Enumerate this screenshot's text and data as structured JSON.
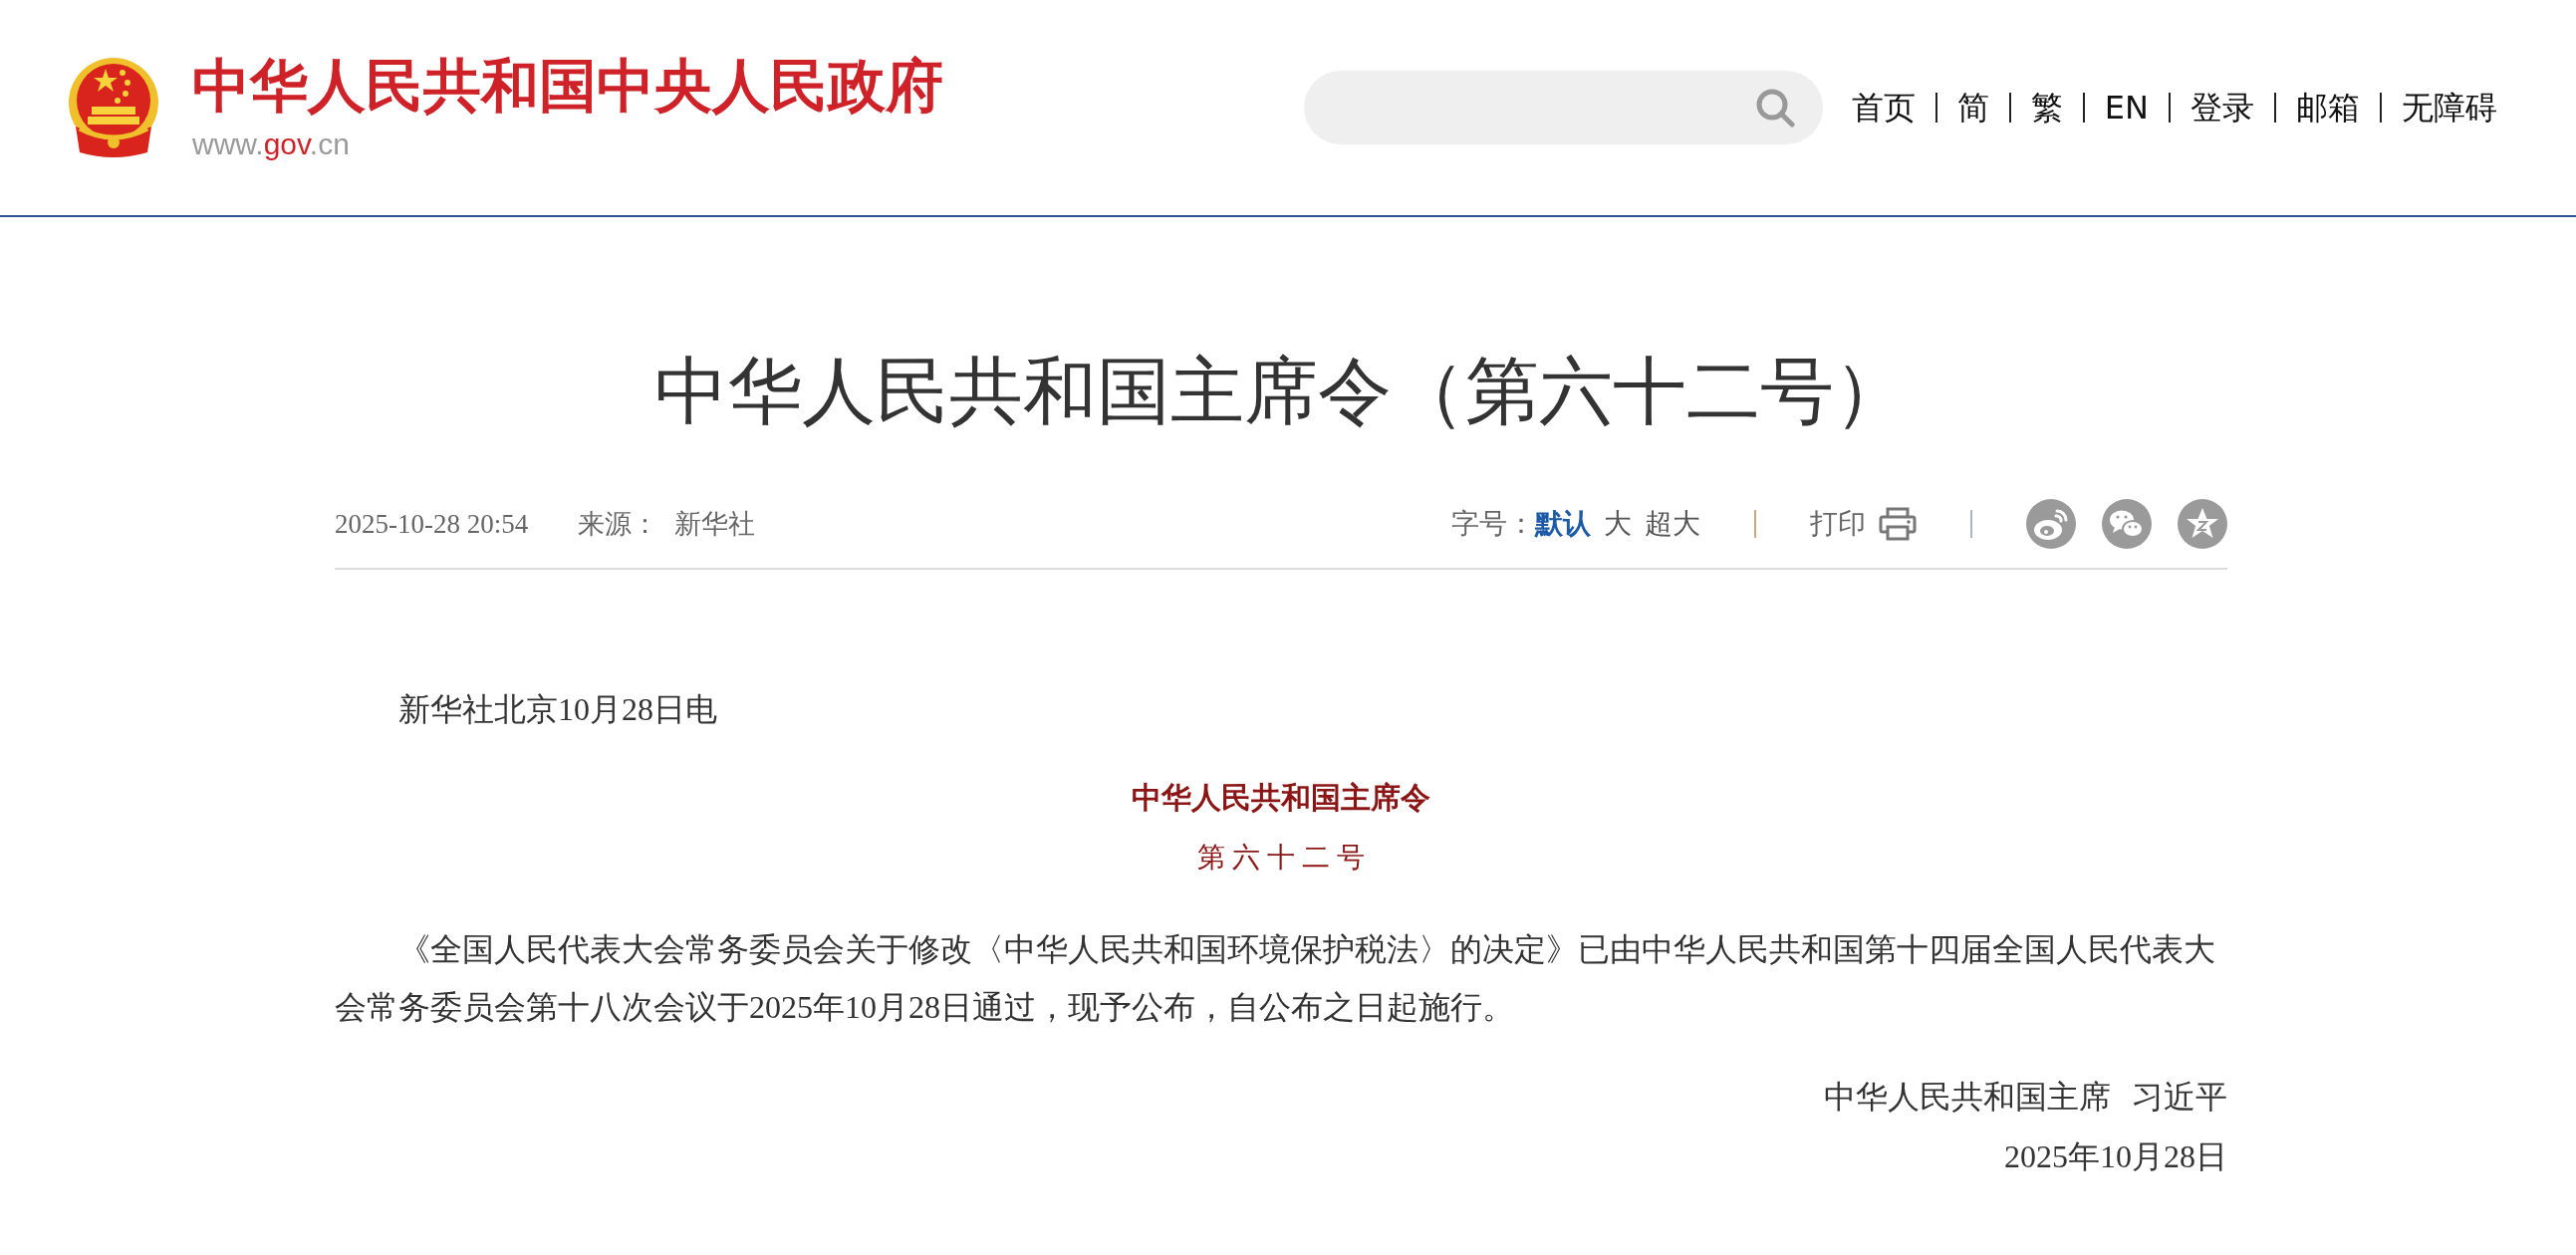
{
  "header": {
    "site_title": "中华人民共和国中央人民政府",
    "site_url": [
      {
        "text": "www.",
        "kind": "plain"
      },
      {
        "text": "gov",
        "kind": "accent"
      },
      {
        "text": ".cn",
        "kind": "plain"
      }
    ],
    "nav": [
      {
        "label": "首页"
      },
      {
        "label": "简"
      },
      {
        "label": "繁"
      },
      {
        "label": "EN"
      },
      {
        "label": "登录"
      },
      {
        "label": "邮箱"
      },
      {
        "label": "无障碍"
      }
    ]
  },
  "article": {
    "title": "中华人民共和国主席令（第六十二号）",
    "meta": {
      "datetime": "2025-10-28 20:54",
      "source_label": "来源：",
      "source": "新华社"
    },
    "font_size": {
      "label": "字号：",
      "options": [
        {
          "label": "默认",
          "selected": true
        },
        {
          "label": "大",
          "selected": false
        },
        {
          "label": "超大",
          "selected": false
        }
      ]
    },
    "print": {
      "label": "打印"
    },
    "body": [
      {
        "kind": "dateline",
        "text": "新华社北京10月28日电"
      },
      {
        "kind": "heading",
        "text": "中华人民共和国主席令"
      },
      {
        "kind": "number",
        "text": "第六十二号"
      },
      {
        "kind": "paragraph",
        "text": "《全国人民代表大会常务委员会关于修改〈中华人民共和国环境保护税法〉的决定》已由中华人民共和国第十四届全国人民代表大会常务委员会第十八次会议于2025年10月28日通过，现予公布，自公布之日起施行。"
      },
      {
        "kind": "signature",
        "text": "中华人民共和国主席 习近平"
      },
      {
        "kind": "date",
        "text": "2025年10月28日"
      }
    ]
  }
}
